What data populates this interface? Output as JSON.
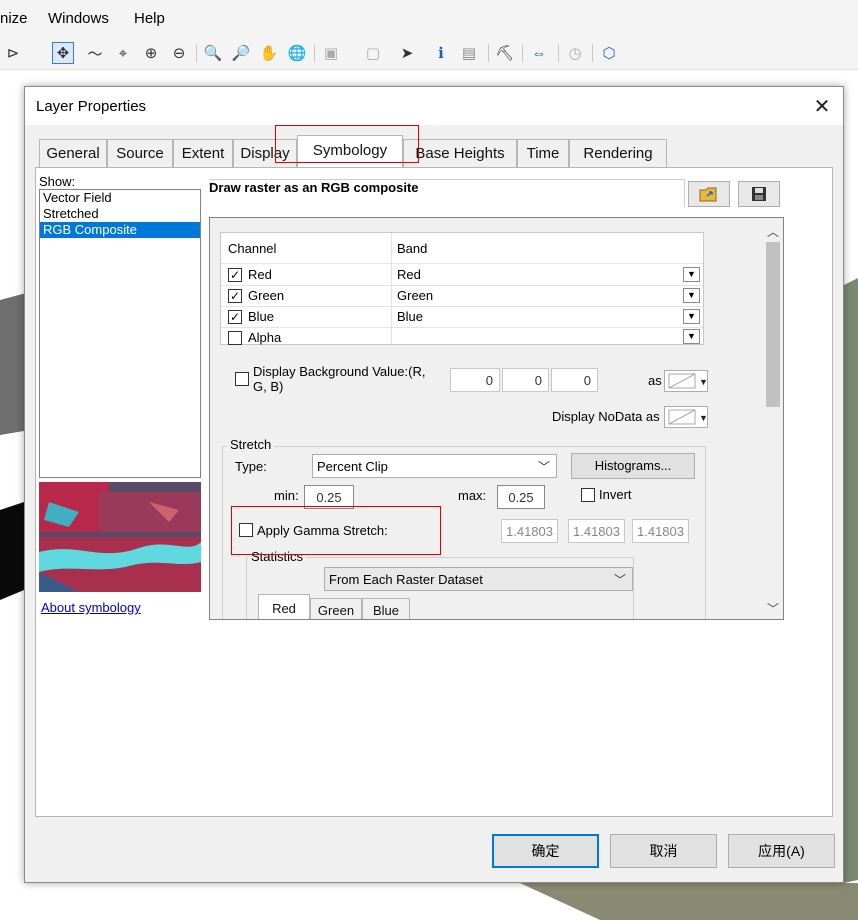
{
  "app": {
    "menu": [
      "nize",
      "Windows",
      "Help"
    ]
  },
  "dialog": {
    "title": "Layer Properties",
    "close_glyph": "✕",
    "tabs": [
      {
        "label": "General"
      },
      {
        "label": "Source"
      },
      {
        "label": "Extent"
      },
      {
        "label": "Display"
      },
      {
        "label": "Symbology"
      },
      {
        "label": "Base Heights"
      },
      {
        "label": "Time"
      },
      {
        "label": "Rendering"
      }
    ],
    "active_tab": "Symbology",
    "show": {
      "label": "Show:",
      "items": [
        "Vector Field",
        "Stretched",
        "RGB Composite"
      ],
      "selected": "RGB Composite"
    },
    "about_link": "About symbology",
    "heading": "Draw raster as an RGB composite",
    "channels": {
      "header_channel": "Channel",
      "header_band": "Band",
      "rows": [
        {
          "channel": "Red",
          "band": "Red",
          "checked": true
        },
        {
          "channel": "Green",
          "band": "Green",
          "checked": true
        },
        {
          "channel": "Blue",
          "band": "Blue",
          "checked": true
        },
        {
          "channel": "Alpha",
          "band": "",
          "checked": false
        }
      ]
    },
    "background": {
      "label": "Display Background Value:(R, G, B)",
      "r": "0",
      "g": "0",
      "b": "0",
      "as_label": "as",
      "nodata_label": "Display NoData as"
    },
    "stretch": {
      "group_label": "Stretch",
      "type_label": "Type:",
      "type_value": "Percent Clip",
      "histograms_button": "Histograms...",
      "min_label": "min:",
      "min_value": "0.25",
      "max_label": "max:",
      "max_value": "0.25",
      "invert_label": "Invert",
      "gamma_label": "Apply Gamma Stretch:",
      "gamma_values": [
        "1.41803",
        "1.41803",
        "1.41803"
      ]
    },
    "statistics": {
      "label": "Statistics",
      "source_value": "From Each Raster Dataset",
      "tabs": [
        "Red",
        "Green",
        "Blue"
      ]
    },
    "buttons": {
      "ok": "确定",
      "cancel": "取消",
      "apply": "应用(A)"
    }
  },
  "colors": {
    "selection": "#0078d7",
    "highlight_box": "#e00000",
    "link": "#0000cc"
  }
}
